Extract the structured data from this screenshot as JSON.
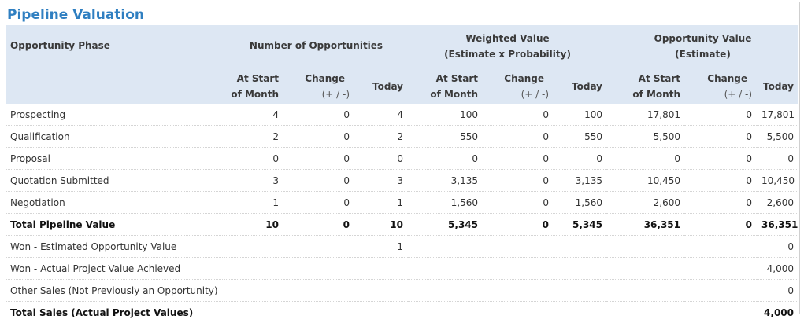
{
  "title": "Pipeline Valuation",
  "headers": {
    "phase": "Opportunity Phase",
    "num_opps": "Number of Opportunities",
    "weighted_line1": "Weighted Value",
    "weighted_line2": "(Estimate x Probability)",
    "oppval_line1": "Opportunity Value",
    "oppval_line2": "(Estimate)",
    "at_start_1": "At Start",
    "at_start_2": "of Month",
    "change_1": "Change",
    "change_2": "(+ / -)",
    "today": "Today"
  },
  "rows": [
    {
      "label": "Prospecting",
      "n_start": "4",
      "n_change": "0",
      "n_today": "4",
      "w_start": "100",
      "w_change": "0",
      "w_today": "100",
      "o_start": "17,801",
      "o_change": "0",
      "o_today": "17,801"
    },
    {
      "label": "Qualification",
      "n_start": "2",
      "n_change": "0",
      "n_today": "2",
      "w_start": "550",
      "w_change": "0",
      "w_today": "550",
      "o_start": "5,500",
      "o_change": "0",
      "o_today": "5,500"
    },
    {
      "label": "Proposal",
      "n_start": "0",
      "n_change": "0",
      "n_today": "0",
      "w_start": "0",
      "w_change": "0",
      "w_today": "0",
      "o_start": "0",
      "o_change": "0",
      "o_today": "0"
    },
    {
      "label": "Quotation Submitted",
      "n_start": "3",
      "n_change": "0",
      "n_today": "3",
      "w_start": "3,135",
      "w_change": "0",
      "w_today": "3,135",
      "o_start": "10,450",
      "o_change": "0",
      "o_today": "10,450"
    },
    {
      "label": "Negotiation",
      "n_start": "1",
      "n_change": "0",
      "n_today": "1",
      "w_start": "1,560",
      "w_change": "0",
      "w_today": "1,560",
      "o_start": "2,600",
      "o_change": "0",
      "o_today": "2,600"
    },
    {
      "label": "Total Pipeline Value",
      "n_start": "10",
      "n_change": "0",
      "n_today": "10",
      "w_start": "5,345",
      "w_change": "0",
      "w_today": "5,345",
      "o_start": "36,351",
      "o_change": "0",
      "o_today": "36,351",
      "total": true
    },
    {
      "label": "Won - Estimated Opportunity Value",
      "n_start": "",
      "n_change": "",
      "n_today": "1",
      "w_start": "",
      "w_change": "",
      "w_today": "",
      "o_start": "",
      "o_change": "",
      "o_today": "0"
    },
    {
      "label": "Won - Actual Project Value Achieved",
      "n_start": "",
      "n_change": "",
      "n_today": "",
      "w_start": "",
      "w_change": "",
      "w_today": "",
      "o_start": "",
      "o_change": "",
      "o_today": "4,000"
    },
    {
      "label": "Other Sales (Not Previously an Opportunity)",
      "n_start": "",
      "n_change": "",
      "n_today": "",
      "w_start": "",
      "w_change": "",
      "w_today": "",
      "o_start": "",
      "o_change": "",
      "o_today": "0"
    },
    {
      "label": "Total Sales (Actual Project Values)",
      "n_start": "",
      "n_change": "",
      "n_today": "",
      "w_start": "",
      "w_change": "",
      "w_today": "",
      "o_start": "",
      "o_change": "",
      "o_today": "4,000",
      "total": true
    }
  ]
}
